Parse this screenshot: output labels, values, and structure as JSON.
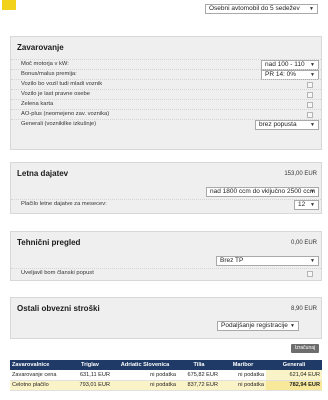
{
  "top": {
    "vehicle_type": "Osebni avtomobil do 5 sedežev"
  },
  "zavarovanje": {
    "title": "Zavarovanje",
    "rows": [
      {
        "label": "Moč motorja v kW:",
        "value": "nad 100 - 110"
      },
      {
        "label": "Bonus/malus premija:",
        "value": "PR 14: 0%"
      },
      {
        "label": "Vozilo bo vozil tudi mladi voznik"
      },
      {
        "label": "Vozilo je last pravne osebe"
      },
      {
        "label": "Zelena karta"
      },
      {
        "label": "AO-plus (neomejeno zav. voznika)"
      },
      {
        "label": "Generali (voznikilke izkušnje)",
        "value": "brez popusta"
      }
    ]
  },
  "letna_dajatev": {
    "title": "Letna dajatev",
    "amount": "153,00 EUR",
    "engine_select": "nad 1800 ccm do vključno 2500 ccm",
    "monthly_label": "Plačilo letne dajatve za mesecev:",
    "monthly_value": "12"
  },
  "tehnicni": {
    "title": "Tehnični pregled",
    "amount": "0,00 EUR",
    "select": "Brez TP",
    "discount_label": "Uveljavil bom članski popust"
  },
  "ostali": {
    "title": "Ostali obvezni stroški",
    "amount": "8,90 EUR",
    "select": "Podaljšanje registracije"
  },
  "print_button": "Izračunaj",
  "comparison": {
    "headers": [
      "Zavarovalnice",
      "Triglav",
      "Adriatic Slovenica",
      "Tilia",
      "Maribor",
      "Generali"
    ],
    "rows": [
      {
        "label": "Zavarovanje cena",
        "values": [
          "631,11 EUR",
          "ni podatka",
          "675,82 EUR",
          "ni podatka",
          "621,04 EUR"
        ]
      },
      {
        "label": "Celotno plačilo",
        "values": [
          "793,01 EUR",
          "ni podatka",
          "837,72 EUR",
          "ni podatka",
          "782,94 EUR"
        ]
      }
    ]
  }
}
